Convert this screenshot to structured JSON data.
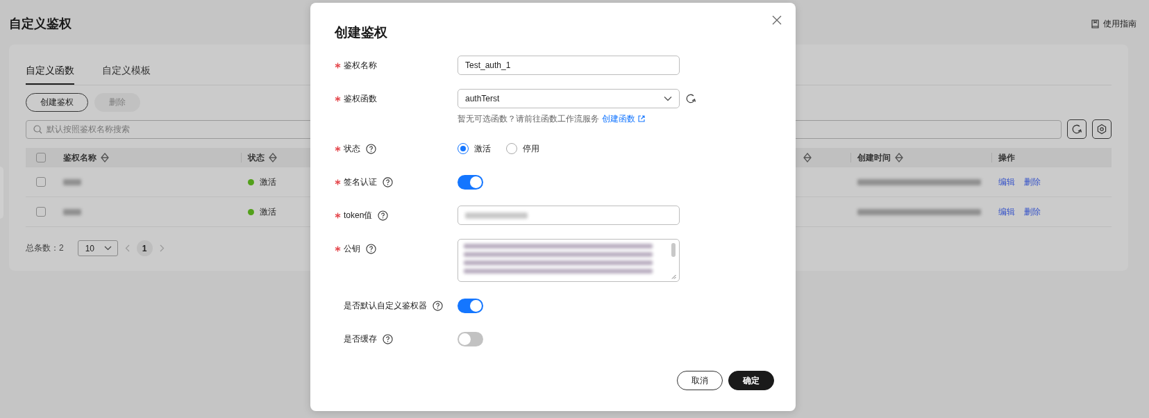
{
  "page": {
    "title": "自定义鉴权",
    "guide_link": "使用指南"
  },
  "tabs": [
    {
      "label": "自定义函数",
      "selected": true
    },
    {
      "label": "自定义模板",
      "selected": false
    }
  ],
  "toolbar": [
    {
      "label": "创建鉴权",
      "disabled": false
    },
    {
      "label": "删除",
      "disabled": true
    }
  ],
  "search": {
    "placeholder": "默认按照鉴权名称搜索"
  },
  "table": {
    "select_all": {
      "checked": false
    },
    "columns": [
      {
        "label": "鉴权名称",
        "sortable": true
      },
      {
        "label": "状态",
        "sortable": true
      },
      {
        "label": "创建时间",
        "sortable": true
      },
      {
        "label": "操作",
        "sortable": false
      }
    ],
    "rows": [
      {
        "checked": false,
        "status": "激活",
        "color": "#52a01a",
        "actions": [
          "编辑",
          "删除"
        ]
      },
      {
        "checked": false,
        "status": "激活",
        "color": "#52a01a",
        "actions": [
          "编辑",
          "删除"
        ]
      }
    ]
  },
  "pagination": {
    "total": "总条数：2",
    "page_size": "10",
    "pages": [
      {
        "label": "1",
        "selected": true
      }
    ]
  },
  "dialog": {
    "title": "创建鉴权",
    "fields": [
      {
        "kind": "text",
        "label": "鉴权名称",
        "required": true,
        "help": false,
        "value": "Test_auth_1"
      },
      {
        "kind": "select",
        "label": "鉴权函数",
        "required": true,
        "help": false,
        "value": "authTerst",
        "hint": "暂无可选函数？请前往函数工作流服务",
        "hint_link": "创建函数"
      },
      {
        "kind": "radio",
        "label": "状态",
        "required": true,
        "help": true,
        "options": [
          {
            "label": "激活",
            "selected": true
          },
          {
            "label": "停用",
            "selected": false
          }
        ]
      },
      {
        "kind": "switch",
        "label": "签名认证",
        "required": true,
        "help": true,
        "on": true
      },
      {
        "kind": "secret",
        "label": "token值",
        "required": true,
        "help": true
      },
      {
        "kind": "textarea",
        "label": "公钥",
        "required": true,
        "help": true
      },
      {
        "kind": "switch",
        "label": "是否默认自定义鉴权器",
        "required": false,
        "help": true,
        "on": true
      },
      {
        "kind": "switch",
        "label": "是否缓存",
        "required": false,
        "help": true,
        "on": false
      }
    ],
    "buttons": [
      {
        "label": "取消",
        "kind": "secondary"
      },
      {
        "label": "确定",
        "kind": "primary"
      }
    ]
  }
}
